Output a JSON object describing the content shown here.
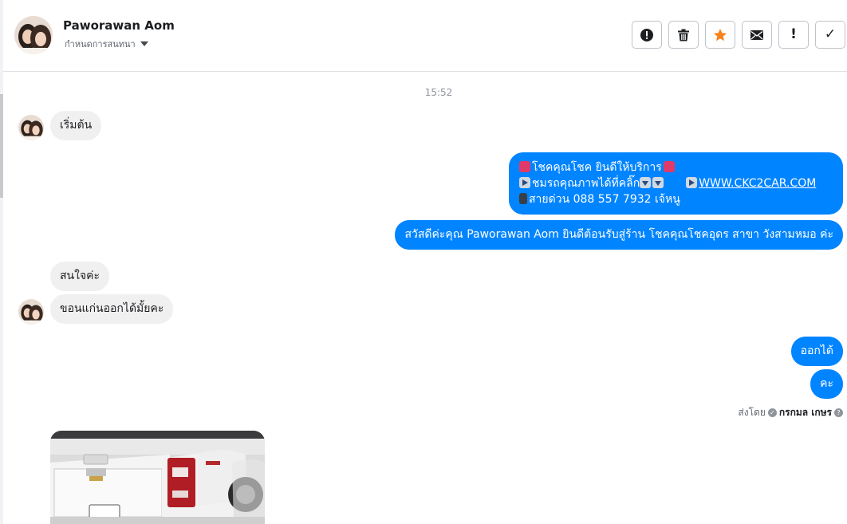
{
  "header": {
    "contact_name": "Paworawan Aom",
    "assign_label": "กำหนดการสนทนา",
    "toolbar": [
      {
        "name": "spam-alert-button",
        "icon": "alert-circle-icon",
        "glyph": ""
      },
      {
        "name": "delete-button",
        "icon": "trash-icon",
        "glyph": ""
      },
      {
        "name": "star-button",
        "icon": "star-icon",
        "glyph": ""
      },
      {
        "name": "mark-unread-button",
        "icon": "envelope-icon",
        "glyph": ""
      },
      {
        "name": "follow-up-button",
        "icon": "exclamation-icon",
        "glyph": "!"
      },
      {
        "name": "mark-done-button",
        "icon": "check-icon",
        "glyph": "✓"
      }
    ]
  },
  "thread": {
    "timestamp": "15:52",
    "msg_start": "เริ่มต้น",
    "msg_promo_line1": "โชคคุณโชค ยินดีให้บริการ",
    "msg_promo_line2": "ชมรถคุณภาพได้ที่คลิ๊ก",
    "msg_promo_link": "WWW.CKC2CAR.COM",
    "msg_promo_line3": "สายด่วน 088 557 7932 เจ้หนู",
    "msg_welcome": "สวัสดีค่ะคุณ Paworawan Aom ยินดีต้อนรับสู่ร้าน โชคคุณโชคอุดร สาขา วังสามหมอ ค่ะ",
    "msg_interested": "สนใจค่ะ",
    "msg_question": "ขอนแก่นออกได้มั้ยคะ",
    "msg_reply1": "ออกได้",
    "msg_reply2": "คะ",
    "sent_by_label": "ส่งโดย",
    "sent_by_name": "กรกมล เกษร",
    "help_icon_glyph": "?",
    "check_icon_glyph": "✓"
  },
  "colors": {
    "outgoing_bubble": "#0084ff",
    "incoming_bubble": "#f1f0f0",
    "star": "#f5841f"
  }
}
